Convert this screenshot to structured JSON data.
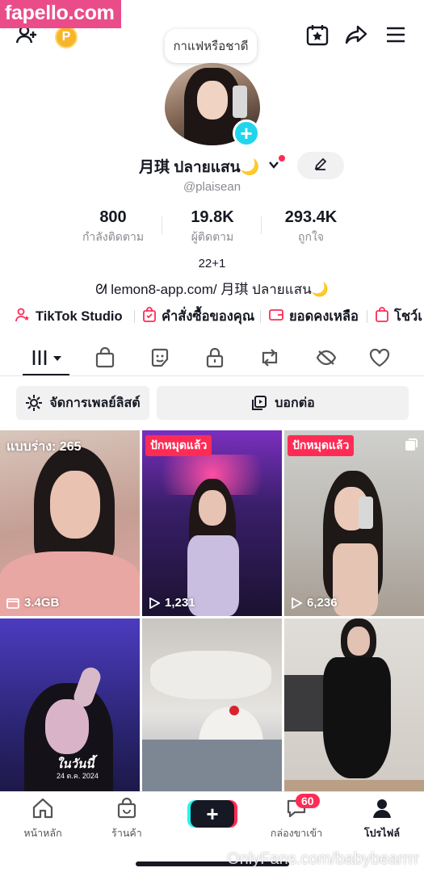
{
  "watermark": {
    "top": "fapello.com",
    "bottom": "OnlyFans.com/babybearrrr"
  },
  "topbar": {
    "add_friend_icon": "person-plus-icon",
    "coin_label": "P",
    "calendar_icon": "calendar-star-icon",
    "share_icon": "share-arrow-icon",
    "menu_icon": "hamburger-menu-icon"
  },
  "profile": {
    "status_bubble": "กาแฟหรือชาดี",
    "name": "月琪 ปลายแสน🌙",
    "handle": "@plaisean",
    "stats": [
      {
        "value": "800",
        "label": "กำลังติดตาม"
      },
      {
        "value": "19.8K",
        "label": "ผู้ติดตาม"
      },
      {
        "value": "293.4K",
        "label": "ถูกใจ"
      }
    ],
    "bio": "22+1",
    "link": "ᘛ lemon8-app.com/ 月琪 ปลายแสน🌙"
  },
  "quick_links": [
    {
      "icon": "tiktok-studio-icon",
      "label": "TikTok Studio"
    },
    {
      "icon": "order-bag-icon",
      "label": "คำสั่งซื้อของคุณ"
    },
    {
      "icon": "wallet-icon",
      "label": "ยอดคงเหลือ"
    },
    {
      "icon": "showcase-icon",
      "label": "โชว์เ"
    }
  ],
  "tabs": [
    "videos-grid-icon",
    "shop-bag-icon",
    "sticker-icon",
    "lock-icon",
    "repost-icon",
    "hidden-eye-icon",
    "heart-icon"
  ],
  "actions": {
    "playlist": "จัดการเพลย์ลิสต์",
    "repost": "บอกต่อ"
  },
  "grid": [
    {
      "overlay": "แบบร่าง: 265",
      "meta": "3.4GB",
      "meta_icon": "folder-icon"
    },
    {
      "tag": "ปักหมุดแล้ว",
      "meta": "1,231",
      "meta_icon": "play-icon"
    },
    {
      "tag": "ปักหมุดแล้ว",
      "meta": "6,236",
      "meta_icon": "play-icon"
    },
    {
      "overlay_caption": "ในวันนี้",
      "overlay_date": "24 ต.ค. 2024"
    },
    {},
    {}
  ],
  "bottom_nav": {
    "home": "หน้าหลัก",
    "shop": "ร้านค้า",
    "inbox": "กล่องขาเข้า",
    "inbox_badge": "60",
    "profile": "โปรไฟล์"
  }
}
